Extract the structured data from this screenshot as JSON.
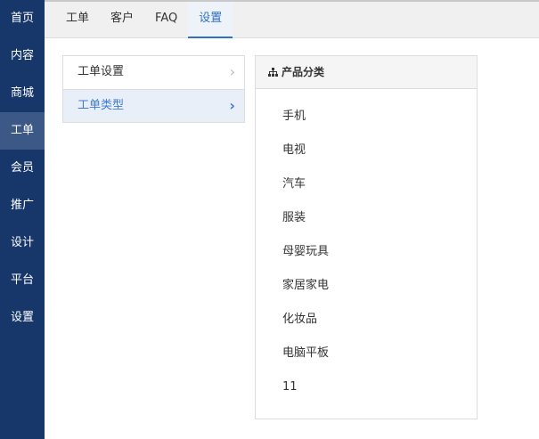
{
  "sidebar": {
    "items": [
      "首页",
      "内容",
      "商城",
      "工单",
      "会员",
      "推广",
      "设计",
      "平台",
      "设置"
    ],
    "active_index": 3
  },
  "tabs": {
    "items": [
      "工单",
      "客户",
      "FAQ",
      "设置"
    ],
    "active_index": 3
  },
  "menu": {
    "items": [
      "工单设置",
      "工单类型"
    ],
    "active_index": 1,
    "chevron": "›"
  },
  "panel": {
    "title": "产品分类",
    "icon": "sitemap-icon",
    "items": [
      "手机",
      "电视",
      "汽车",
      "服装",
      "母婴玩具",
      "家居家电",
      "化妆品",
      "电脑平板",
      "11"
    ]
  }
}
